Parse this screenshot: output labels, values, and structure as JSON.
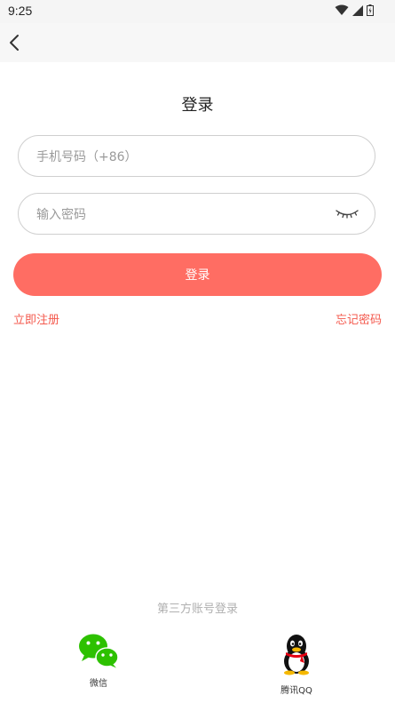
{
  "status_bar": {
    "time": "9:25"
  },
  "page": {
    "title": "登录"
  },
  "form": {
    "phone_placeholder": "手机号码（+86）",
    "phone_value": "",
    "password_placeholder": "输入密码",
    "password_value": "",
    "login_label": "登录"
  },
  "links": {
    "register": "立即注册",
    "forgot_password": "忘记密码"
  },
  "third_party": {
    "title": "第三方账号登录",
    "wechat_label": "微信",
    "qq_label": "腾讯QQ"
  },
  "colors": {
    "accent": "#ff6d63",
    "link": "#f4594d",
    "wechat": "#2dc100"
  }
}
